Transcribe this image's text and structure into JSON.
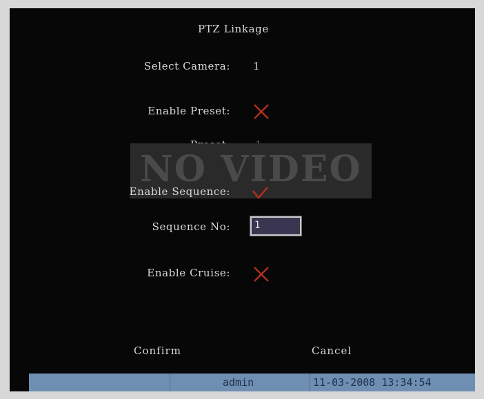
{
  "dialog": {
    "title": "PTZ Linkage",
    "select_camera_label": "Select Camera:",
    "select_camera_value": "1",
    "enable_preset_label": "Enable Preset:",
    "enable_preset_state": "unchecked",
    "preset_label": "Preset:",
    "preset_value": "1",
    "enable_sequence_label": "Enable Sequence:",
    "enable_sequence_state": "checked",
    "sequence_no_label": "Sequence No:",
    "sequence_no_value": "1",
    "enable_cruise_label": "Enable Cruise:",
    "enable_cruise_state": "unchecked"
  },
  "overlay": {
    "no_video": "NO VIDEO"
  },
  "buttons": {
    "confirm": "Confirm",
    "cancel": "Cancel"
  },
  "status_bar": {
    "user": "admin",
    "datetime": "11-03-2008 13:34:54"
  },
  "colors": {
    "cross": "#b03020",
    "check": "#b03020",
    "status_bg": "#6f8fb2"
  }
}
